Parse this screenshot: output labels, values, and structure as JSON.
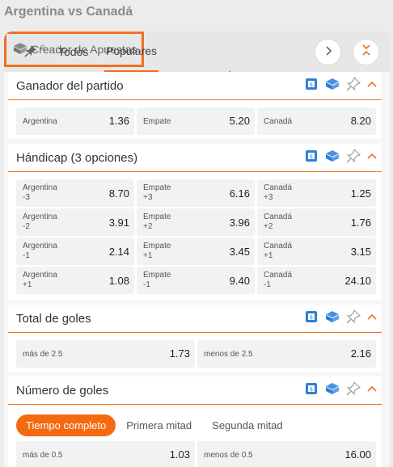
{
  "page_title": "Argentina vs Canadá",
  "tabs": {
    "pin_count": "0",
    "todos": "Todos",
    "populares": "Populares",
    "creador": "Creador de Apuestas"
  },
  "colors": {
    "accent": "#f07020",
    "accent_fill": "#f36a10",
    "icon_blue": "#2f7fd6"
  },
  "sections": {
    "ganador": {
      "title": "Ganador del partido",
      "cells": [
        {
          "label": "Argentina",
          "sub": "",
          "odd": "1.36"
        },
        {
          "label": "Empate",
          "sub": "",
          "odd": "5.20"
        },
        {
          "label": "Canadá",
          "sub": "",
          "odd": "8.20"
        }
      ]
    },
    "handicap": {
      "title": "Hándicap (3 opciones)",
      "rows": [
        [
          {
            "label": "Argentina",
            "sub": "-3",
            "odd": "8.70"
          },
          {
            "label": "Empate",
            "sub": "+3",
            "odd": "6.16"
          },
          {
            "label": "Canadá",
            "sub": "+3",
            "odd": "1.25"
          }
        ],
        [
          {
            "label": "Argentina",
            "sub": "-2",
            "odd": "3.91"
          },
          {
            "label": "Empate",
            "sub": "+2",
            "odd": "3.96"
          },
          {
            "label": "Canadá",
            "sub": "+2",
            "odd": "1.76"
          }
        ],
        [
          {
            "label": "Argentina",
            "sub": "-1",
            "odd": "2.14"
          },
          {
            "label": "Empate",
            "sub": "+1",
            "odd": "3.45"
          },
          {
            "label": "Canadá",
            "sub": "+1",
            "odd": "3.15"
          }
        ],
        [
          {
            "label": "Argentina",
            "sub": "+1",
            "odd": "1.08"
          },
          {
            "label": "Empate",
            "sub": "-1",
            "odd": "9.40"
          },
          {
            "label": "Canadá",
            "sub": "-1",
            "odd": "24.10"
          }
        ]
      ]
    },
    "total": {
      "title": "Total de goles",
      "cells": [
        {
          "label": "más de 2.5",
          "odd": "1.73"
        },
        {
          "label": "menos de 2.5",
          "odd": "2.16"
        }
      ]
    },
    "numero": {
      "title": "Número de goles",
      "subtabs": [
        "Tiempo completo",
        "Primera mitad",
        "Segunda mitad"
      ],
      "cells": [
        {
          "label": "más de 0.5",
          "odd": "1.03"
        },
        {
          "label": "menos de 0.5",
          "odd": "16.00"
        }
      ]
    }
  }
}
